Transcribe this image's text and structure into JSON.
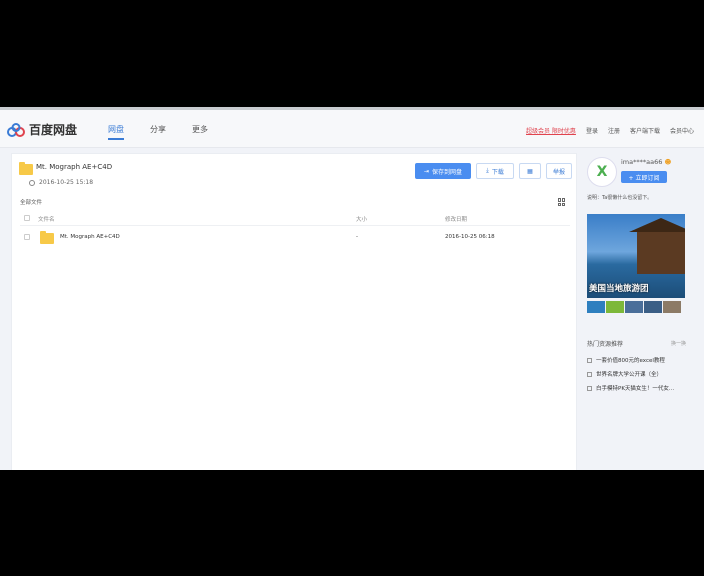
{
  "header": {
    "logo_text": "百度网盘",
    "nav": [
      "网盘",
      "分享",
      "更多"
    ],
    "vip_link": "超级会员 限时优惠",
    "links": [
      "登录",
      "注册",
      "客户端下载",
      "会员中心"
    ]
  },
  "share": {
    "title": "Mt. Mograph AE+C4D",
    "time": "2016-10-25 15:18",
    "buttons": {
      "save": "保存到网盘",
      "download": "下载",
      "report": "举报"
    },
    "breadcrumb": "全部文件",
    "columns": {
      "name": "文件名",
      "size": "大小",
      "date": "修改日期"
    },
    "rows": [
      {
        "name": "Mt. Mograph AE+C4D",
        "size": "-",
        "date": "2016-10-25 06:18"
      }
    ]
  },
  "sidebar": {
    "username": "ima****aa66",
    "subscribe_label": "+ 立即订阅",
    "description": "说明：Ta很懒什么也没留下。",
    "ad_caption": "美国当地旅游团",
    "hot_title": "热门资源推荐",
    "change_label": "换一换",
    "hot_items": [
      "一套价值800元的excel教程",
      "世界名牌大学公开课（全）",
      "白手模特PK天猫女生！一代女..."
    ]
  },
  "colors": {
    "accent": "#4a8df0",
    "folder": "#f7c948",
    "vip": "#e0434e"
  }
}
